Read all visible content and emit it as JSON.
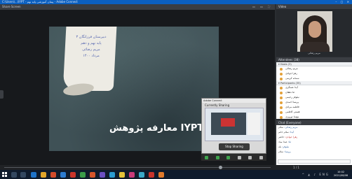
{
  "window": {
    "title": "C:\\Users\\...\\IYPT - پیمان آموزشی پایه نهم - Adobe Connect",
    "controls": "–  ▢  ✕"
  },
  "share_pod": {
    "header": "Share  Screen",
    "controls": "▭ ▭ ⛶"
  },
  "slide": {
    "lines": [
      "دبیرستان فرزانگان ۳",
      "پایه نهم و دهم",
      "مریم رضائی",
      "مرداد ۱۴۰۰"
    ],
    "title": "معارفه پژوهش IYPT"
  },
  "share_window": {
    "title": "Adobe Connect",
    "label": "Currently Sharing",
    "stop_button": "Stop Sharing"
  },
  "video_pod": {
    "header": "Video",
    "camera_name": "مریم رضائی"
  },
  "attendees_pod": {
    "header": "Attendees (38)",
    "hosts_header": "▾ Hosts (3)",
    "hosts": [
      "مریم رضائی",
      "زهرا جوادی",
      "سمانه کریمی"
    ],
    "participants_header": "▾ Participants (35)",
    "participants": [
      "آیدا عسگری",
      "ثنا دهقان",
      "نیلوفر رحیمی",
      "پریسا احمدی",
      "فاطمه مرادی",
      "هستی کاظمی",
      "مهسا نوروزی"
    ]
  },
  "chat_pod": {
    "header": "Chat  (Everyone)",
    "messages": [
      {
        "who": "مریم رضائی:",
        "text": "سلام",
        "red": false
      },
      {
        "who": "آیدا:",
        "text": "سلام خانم",
        "red": false
      },
      {
        "who": "زهرا جوادی:",
        "text": "حاضر",
        "red": true
      },
      {
        "who": "ثنا:",
        "text": "صدا میاد",
        "red": false
      },
      {
        "who": "نیلوفر:",
        "text": "بله",
        "red": false
      },
      {
        "who": "پریسا:",
        "text": "سلام",
        "red": false
      }
    ]
  },
  "meetbar": {
    "page": "1 / 1"
  },
  "taskbar": {
    "tray": "^ ◭ ♪ ENG",
    "time": "10:02",
    "date": "2021/08/08"
  }
}
